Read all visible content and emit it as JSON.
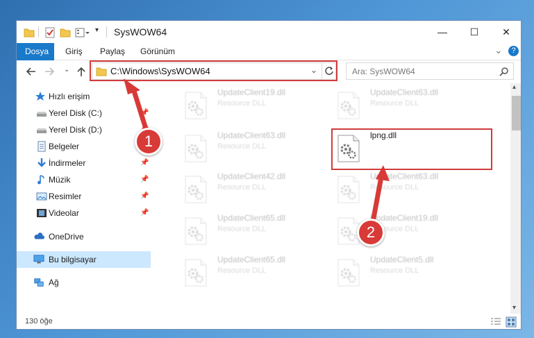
{
  "window": {
    "title": "SysWOW64",
    "min_symbol": "—",
    "max_symbol": "☐",
    "close_symbol": "✕"
  },
  "ribbon": {
    "tabs": [
      "Dosya",
      "Giriş",
      "Paylaş",
      "Görünüm"
    ],
    "expand_symbol": "⌄",
    "help_symbol": "?"
  },
  "nav": {
    "address": "C:\\Windows\\SysWOW64",
    "search_placeholder": "Ara: SysWOW64"
  },
  "sidebar": {
    "items": [
      {
        "label": "Hızlı erişim",
        "icon": "star-icon"
      },
      {
        "label": "Yerel Disk (C:)",
        "icon": "drive-icon",
        "pinned": true
      },
      {
        "label": "Yerel Disk (D:)",
        "icon": "drive-icon",
        "pinned": true
      },
      {
        "label": "Belgeler",
        "icon": "documents-icon",
        "pinned": true
      },
      {
        "label": "İndirmeler",
        "icon": "downloads-icon",
        "pinned": true
      },
      {
        "label": "Müzik",
        "icon": "music-icon",
        "pinned": true
      },
      {
        "label": "Resimler",
        "icon": "pictures-icon",
        "pinned": true
      },
      {
        "label": "Videolar",
        "icon": "videos-icon",
        "pinned": true
      },
      {
        "label": "OneDrive",
        "icon": "onedrive-icon"
      },
      {
        "label": "Bu bilgisayar",
        "icon": "computer-icon",
        "selected": true
      },
      {
        "label": "Ağ",
        "icon": "network-icon"
      }
    ]
  },
  "files": [
    {
      "name": "UpdateClient19.dll",
      "desc": "Resource DLL"
    },
    {
      "name": "UpdateClient63.dll",
      "desc": "Resource DLL"
    },
    {
      "name": "UpdateClient63.dll",
      "desc": "Resource DLL"
    },
    {
      "name": "lpng.dll",
      "desc": ""
    },
    {
      "name": "UpdateClient42.dll",
      "desc": "Resource DLL"
    },
    {
      "name": "UpdateClient63.dll",
      "desc": "Resource DLL"
    },
    {
      "name": "UpdateClient65.dll",
      "desc": "Resource DLL"
    },
    {
      "name": "UpdateClient19.dll",
      "desc": "Resource DLL"
    },
    {
      "name": "UpdateClient65.dll",
      "desc": "Resource DLL"
    },
    {
      "name": "UpdateClient5.dll",
      "desc": "Resource DLL"
    }
  ],
  "status": {
    "count": "130 öğe"
  },
  "annotations": {
    "step1": "1",
    "step2": "2",
    "color": "#d83a37"
  }
}
